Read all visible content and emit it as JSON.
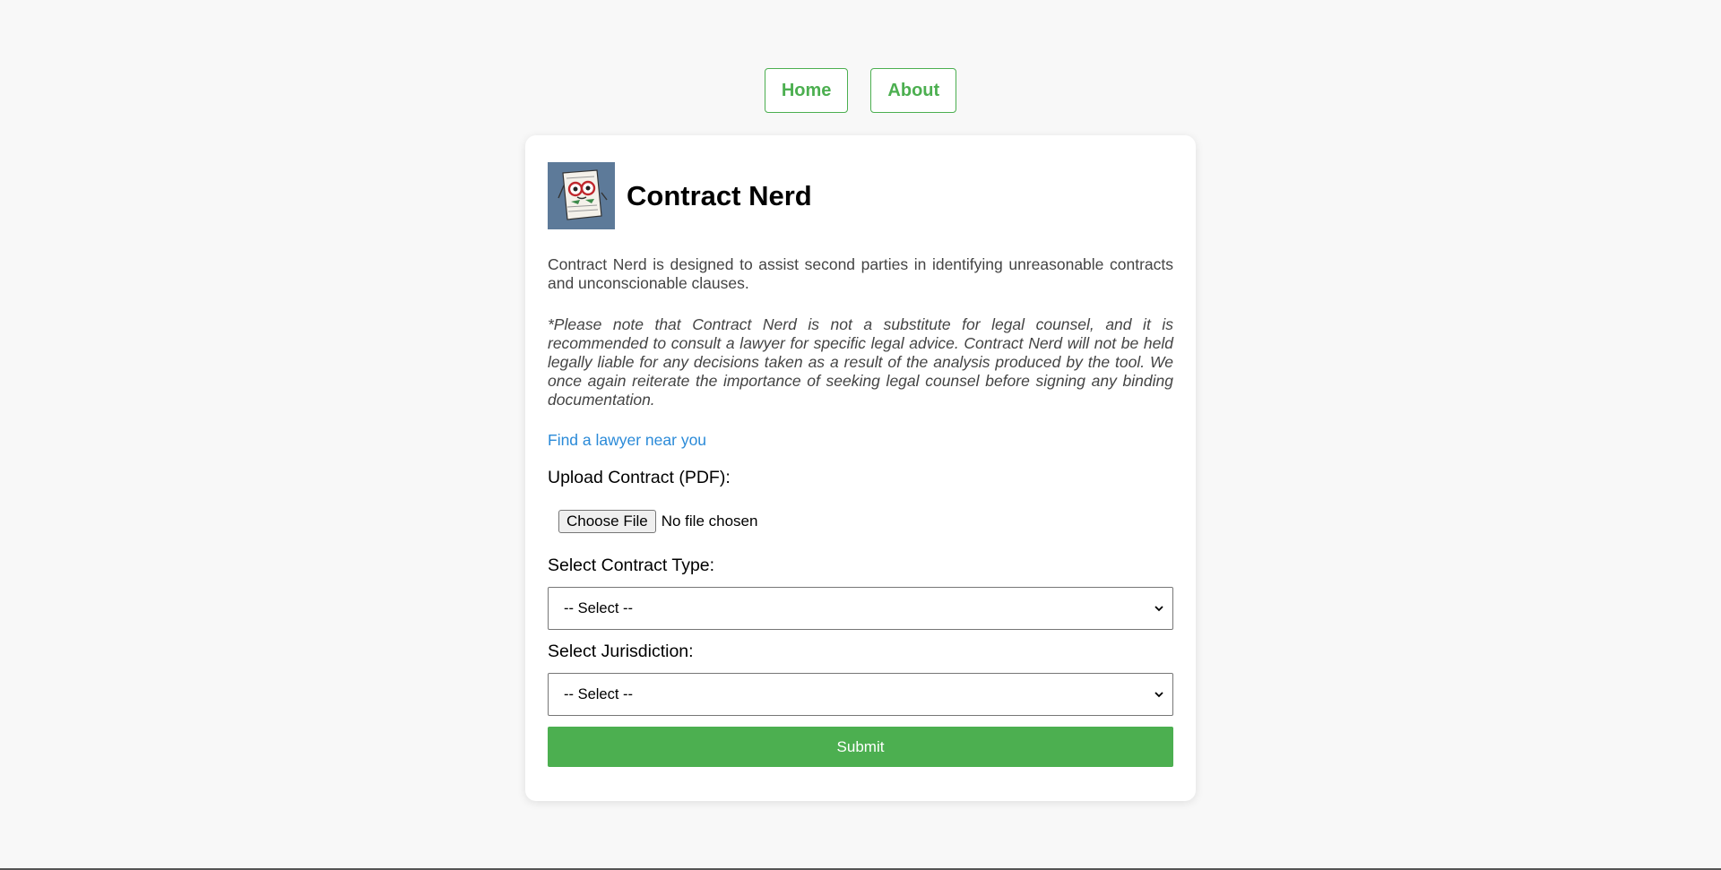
{
  "nav": {
    "home_label": "Home",
    "about_label": "About"
  },
  "header": {
    "title": "Contract Nerd",
    "logo_icon": "contract-nerd-logo-icon"
  },
  "description": "Contract Nerd is designed to assist second parties in identifying unreasonable contracts and unconscionable clauses.",
  "disclaimer": "*Please note that Contract Nerd is not a substitute for legal counsel, and it is recommended to consult a lawyer for specific legal advice. Contract Nerd will not be held legally liable for any decisions taken as a result of the analysis produced by the tool. We once again reiterate the importance of seeking legal counsel before signing any binding documentation.",
  "lawyer_link": "Find a lawyer near you",
  "upload": {
    "label": "Upload Contract (PDF):",
    "button_label": "Choose File",
    "status": "No file chosen"
  },
  "contract_type": {
    "label": "Select Contract Type:",
    "selected": "-- Select --"
  },
  "jurisdiction": {
    "label": "Select Jurisdiction:",
    "selected": "-- Select --"
  },
  "submit_label": "Submit",
  "colors": {
    "accent": "#4caf50",
    "link": "#2a8ad8",
    "background": "#f8f8f8"
  }
}
